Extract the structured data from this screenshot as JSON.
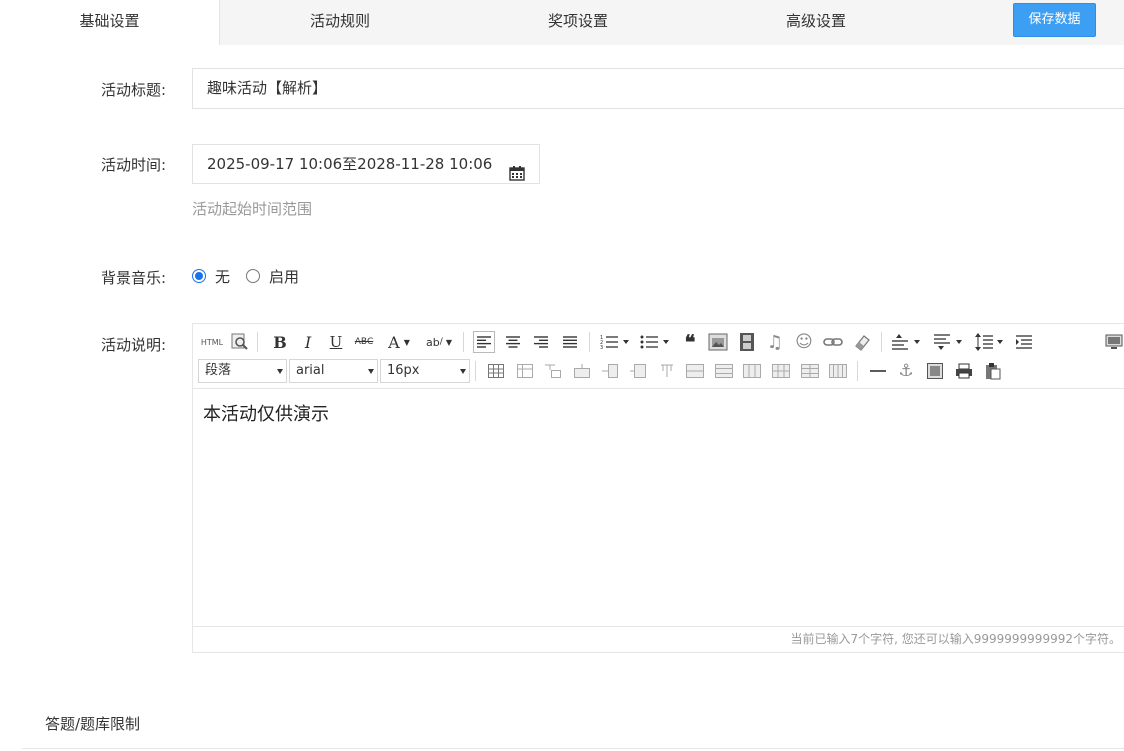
{
  "tabs": [
    {
      "label": "基础设置",
      "active": true
    },
    {
      "label": "活动规则",
      "active": false
    },
    {
      "label": "奖项设置",
      "active": false
    },
    {
      "label": "高级设置",
      "active": false
    }
  ],
  "save_button": "保存数据",
  "form": {
    "title_label": "活动标题:",
    "title_value": "趣味活动【解析】",
    "time_label": "活动时间:",
    "time_value": "2025-09-17 10:06至2028-11-28 10:06",
    "time_hint": "活动起始时间范围",
    "music_label": "背景音乐:",
    "music_options": [
      {
        "label": "无",
        "checked": true
      },
      {
        "label": "启用",
        "checked": false
      }
    ],
    "desc_label": "活动说明:"
  },
  "editor": {
    "paragraph": "段落",
    "font": "arial",
    "size": "16px",
    "html_btn": "HTML",
    "content": "本活动仅供演示",
    "status": "当前已输入7个字符, 您还可以输入9999999999992个字符。"
  },
  "section": {
    "title": "答题/题库限制"
  },
  "colors": {
    "accent": "#3d9ff4",
    "radio": "#1a73e8"
  }
}
